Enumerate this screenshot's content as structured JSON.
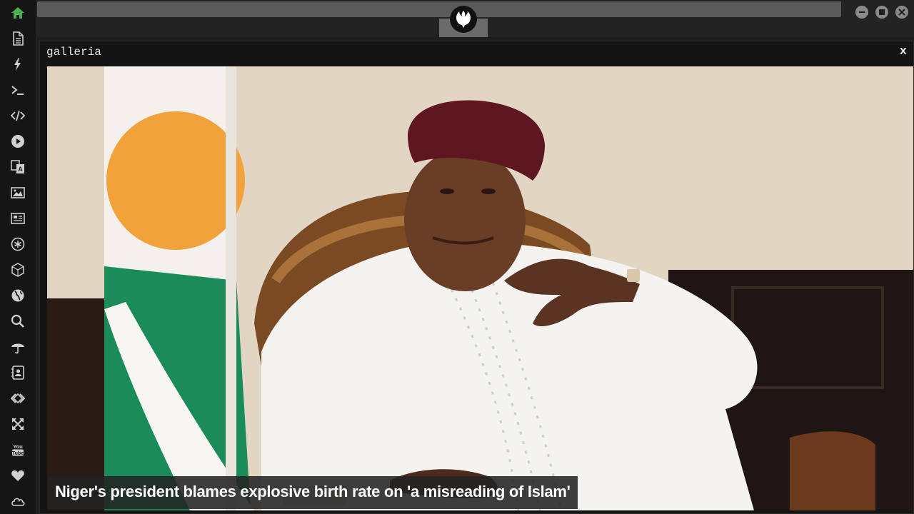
{
  "sidebar": {
    "icons": [
      {
        "name": "home-icon",
        "color": "#4caf50"
      },
      {
        "name": "document-icon"
      },
      {
        "name": "lightning-icon"
      },
      {
        "name": "terminal-icon"
      },
      {
        "name": "code-icon"
      },
      {
        "name": "play-icon"
      },
      {
        "name": "translate-icon"
      },
      {
        "name": "image-icon"
      },
      {
        "name": "newspaper-icon"
      },
      {
        "name": "asterisk-icon"
      },
      {
        "name": "hexagon-icon"
      },
      {
        "name": "globe-icon"
      },
      {
        "name": "search-icon"
      },
      {
        "name": "umbrella-icon"
      },
      {
        "name": "contacts-icon"
      },
      {
        "name": "link-icon"
      },
      {
        "name": "expand-icon"
      },
      {
        "name": "youtube-icon",
        "text": "You Tube"
      },
      {
        "name": "heart-icon"
      },
      {
        "name": "cloud-icon"
      }
    ]
  },
  "topbar": {
    "logo": "rebel-alliance-logo",
    "window_controls": [
      "minimize",
      "maximize",
      "close"
    ]
  },
  "window": {
    "title": "galleria",
    "close_label": "x"
  },
  "gallery": {
    "caption": "Niger's president blames explosive birth rate on 'a misreading of Islam'"
  },
  "colors": {
    "accent_green": "#4caf50",
    "sidebar_icon": "#d0d0d0"
  }
}
